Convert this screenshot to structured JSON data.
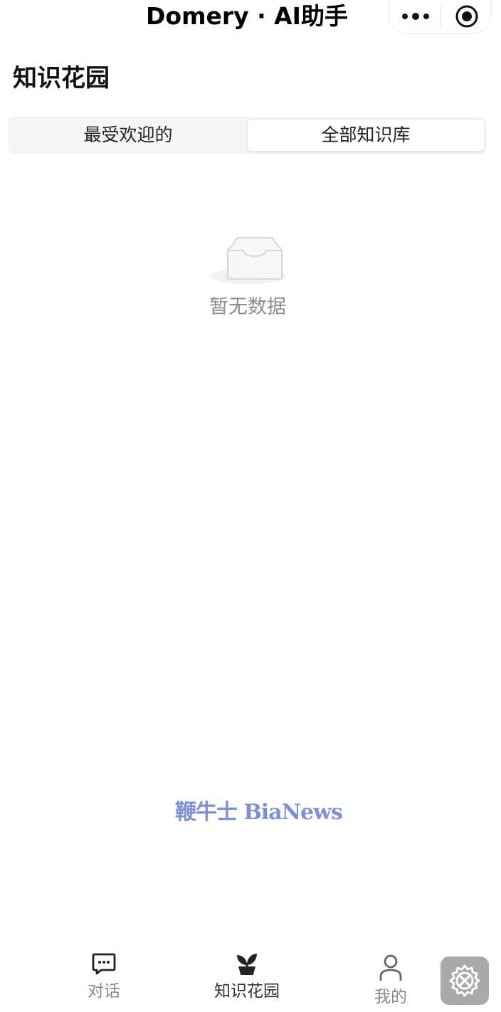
{
  "window": {
    "title": "Domery · AI助手"
  },
  "capsule": {
    "more_icon": "more-dots-icon",
    "close_icon": "target-circle-icon"
  },
  "page": {
    "title": "知识花园"
  },
  "segments": {
    "items": [
      {
        "label": "最受欢迎的",
        "selected": false
      },
      {
        "label": "全部知识库",
        "selected": true
      }
    ]
  },
  "empty_state": {
    "icon": "empty-inbox-icon",
    "text": "暂无数据"
  },
  "watermark": {
    "text": "鞭牛士 BiaNews"
  },
  "tabbar": {
    "items": [
      {
        "label": "对话",
        "icon": "chat-bubble-icon",
        "active": false
      },
      {
        "label": "知识花园",
        "icon": "sprout-icon",
        "active": true
      },
      {
        "label": "我的",
        "icon": "person-icon",
        "active": false
      }
    ]
  },
  "floating_tool": {
    "icon": "tools-gear-icon"
  },
  "colors": {
    "background": "#ffffff",
    "segment_bg": "#f5f5f5",
    "muted_text": "#8c8c8c",
    "watermark": "#7c8fd8",
    "tool_button": "#a9a9a9"
  }
}
